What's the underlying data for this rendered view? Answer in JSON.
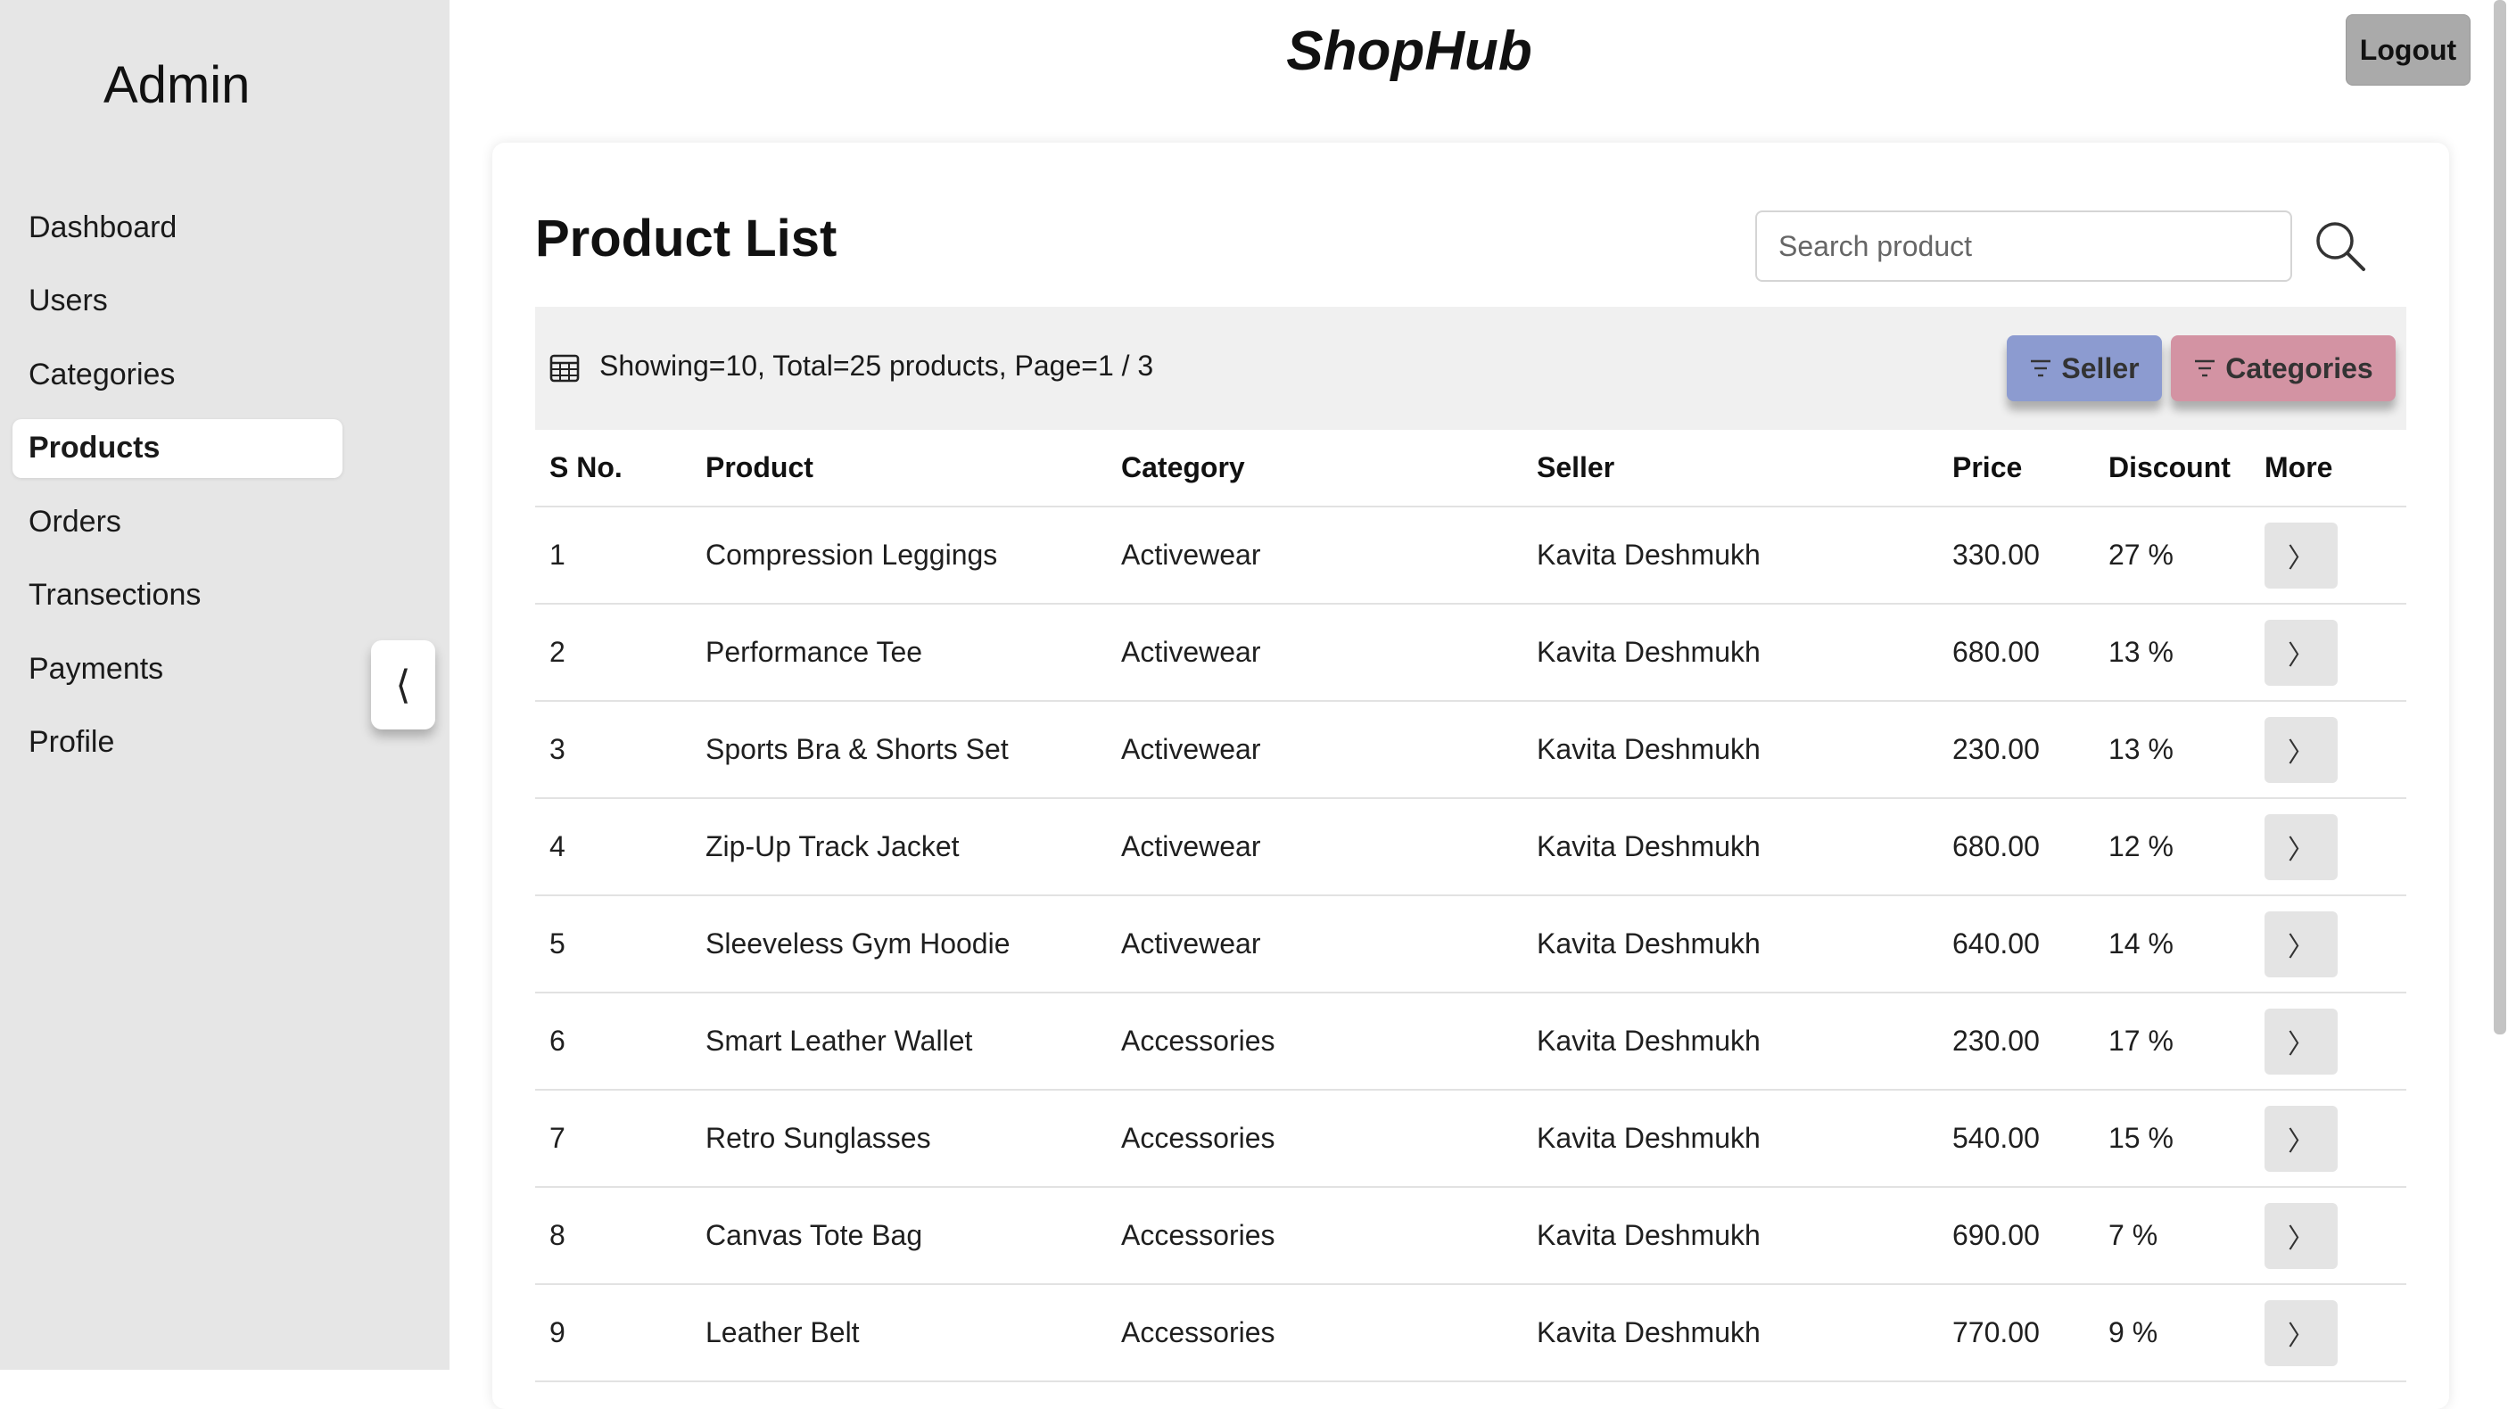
{
  "sidebar": {
    "brand": "Admin",
    "items": [
      {
        "id": "dashboard",
        "label": "Dashboard",
        "active": false
      },
      {
        "id": "users",
        "label": "Users",
        "active": false
      },
      {
        "id": "categories",
        "label": "Categories",
        "active": false
      },
      {
        "id": "products",
        "label": "Products",
        "active": true
      },
      {
        "id": "orders",
        "label": "Orders",
        "active": false
      },
      {
        "id": "transections",
        "label": "Transections",
        "active": false
      },
      {
        "id": "payments",
        "label": "Payments",
        "active": false
      },
      {
        "id": "profile",
        "label": "Profile",
        "active": false
      }
    ],
    "collapse_icon": "⟨"
  },
  "header": {
    "app_name": "ShopHub",
    "logout_label": "Logout"
  },
  "main": {
    "title": "Product List",
    "search": {
      "placeholder": "Search product",
      "value": "",
      "icon": "search-icon"
    },
    "info": {
      "icon": "table-icon",
      "text": "Showing=10, Total=25 products, Page=1 / 3"
    },
    "filters": {
      "seller_label": "Seller",
      "categories_label": "Categories",
      "seller_color": "#8c9bd0",
      "categories_color": "#d393a3"
    },
    "table": {
      "columns": [
        "S No.",
        "Product",
        "Category",
        "Seller",
        "Price",
        "Discount",
        "More"
      ],
      "more_icon": "〉",
      "rows": [
        {
          "sno": "1",
          "product": "Compression Leggings",
          "category": "Activewear",
          "seller": "Kavita Deshmukh",
          "price": "330.00",
          "discount": "27 %"
        },
        {
          "sno": "2",
          "product": "Performance Tee",
          "category": "Activewear",
          "seller": "Kavita Deshmukh",
          "price": "680.00",
          "discount": "13 %"
        },
        {
          "sno": "3",
          "product": "Sports Bra & Shorts Set",
          "category": "Activewear",
          "seller": "Kavita Deshmukh",
          "price": "230.00",
          "discount": "13 %"
        },
        {
          "sno": "4",
          "product": "Zip-Up Track Jacket",
          "category": "Activewear",
          "seller": "Kavita Deshmukh",
          "price": "680.00",
          "discount": "12 %"
        },
        {
          "sno": "5",
          "product": "Sleeveless Gym Hoodie",
          "category": "Activewear",
          "seller": "Kavita Deshmukh",
          "price": "640.00",
          "discount": "14 %"
        },
        {
          "sno": "6",
          "product": "Smart Leather Wallet",
          "category": "Accessories",
          "seller": "Kavita Deshmukh",
          "price": "230.00",
          "discount": "17 %"
        },
        {
          "sno": "7",
          "product": "Retro Sunglasses",
          "category": "Accessories",
          "seller": "Kavita Deshmukh",
          "price": "540.00",
          "discount": "15 %"
        },
        {
          "sno": "8",
          "product": "Canvas Tote Bag",
          "category": "Accessories",
          "seller": "Kavita Deshmukh",
          "price": "690.00",
          "discount": "7 %"
        },
        {
          "sno": "9",
          "product": "Leather Belt",
          "category": "Accessories",
          "seller": "Kavita Deshmukh",
          "price": "770.00",
          "discount": "9 %"
        }
      ]
    }
  }
}
